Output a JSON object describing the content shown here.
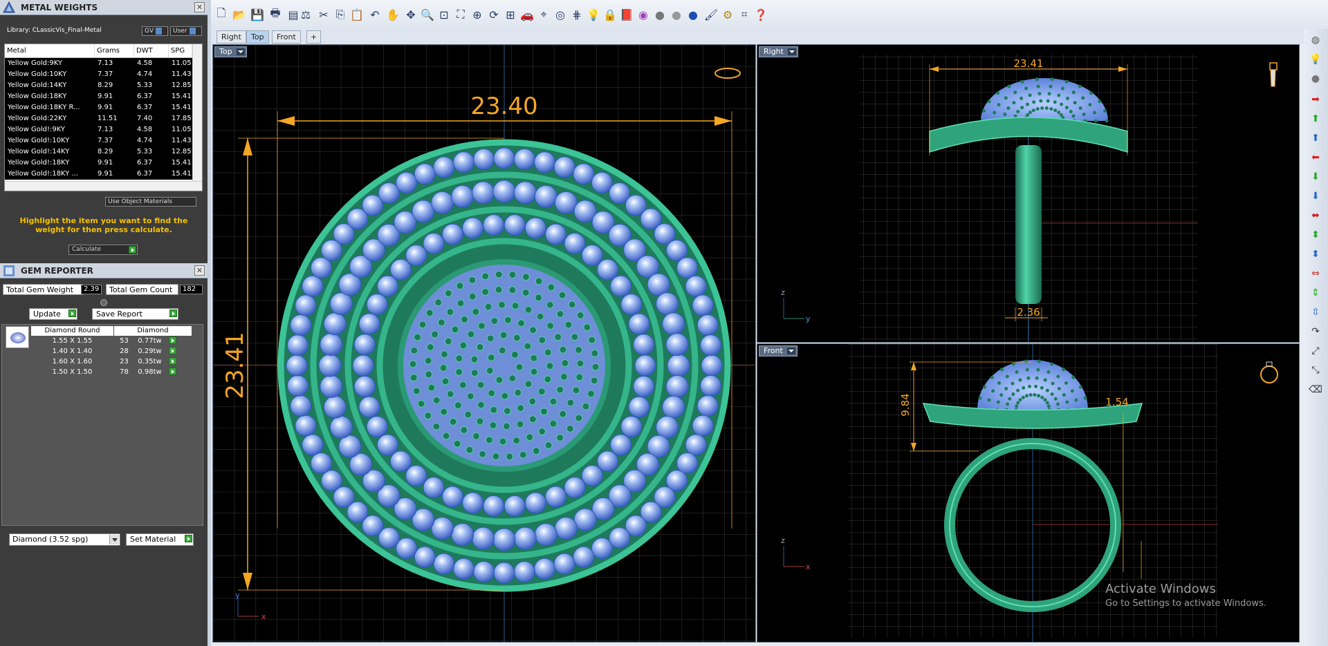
{
  "metal_panel": {
    "title": "METAL WEIGHTS",
    "library": "Library: CLassicVis_Final-Metal",
    "gv_label": "GV",
    "user_label": "User",
    "columns": [
      "Metal",
      "Grams",
      "DWT",
      "SPG"
    ],
    "rows": [
      [
        "Yellow Gold:9KY",
        "7.13",
        "4.58",
        "11.05"
      ],
      [
        "Yellow Gold:10KY",
        "7.37",
        "4.74",
        "11.43"
      ],
      [
        "Yellow Gold:14KY",
        "8.29",
        "5.33",
        "12.85"
      ],
      [
        "Yellow Gold:18KY",
        "9.91",
        "6.37",
        "15.41"
      ],
      [
        "Yellow Gold:18KY R...",
        "9.91",
        "6.37",
        "15.41"
      ],
      [
        "Yellow Gold:22KY",
        "11.51",
        "7.40",
        "17.85"
      ],
      [
        "Yellow Gold!:9KY",
        "7.13",
        "4.58",
        "11.05"
      ],
      [
        "Yellow Gold!:10KY",
        "7.37",
        "4.74",
        "11.43"
      ],
      [
        "Yellow Gold!:14KY",
        "8.29",
        "5.33",
        "12.85"
      ],
      [
        "Yellow Gold!:18KY",
        "9.91",
        "6.37",
        "15.41"
      ],
      [
        "Yellow Gold!:18KY ...",
        "9.91",
        "6.37",
        "15.41"
      ]
    ],
    "use_object_materials": "Use Object Materials",
    "hint": "Highlight the item you want to find the weight for then press calculate.",
    "calculate_label": "Calculate"
  },
  "gem_panel": {
    "title": "GEM REPORTER",
    "total_weight_label": "Total Gem Weight",
    "total_weight_value": "2.39",
    "total_count_label": "Total Gem Count",
    "total_count_value": "182",
    "update_label": "Update",
    "save_report_label": "Save Report",
    "columns": [
      "Diamond Round",
      "Diamond"
    ],
    "rows": [
      [
        "1.55 X 1.55",
        "53",
        "0.77tw"
      ],
      [
        "1.40 X 1.40",
        "28",
        "0.29tw"
      ],
      [
        "1.60 X 1.60",
        "23",
        "0.35tw"
      ],
      [
        "1.50 X 1.50",
        "78",
        "0.98tw"
      ]
    ],
    "material_select": "Diamond    (3.52 spg)",
    "set_material_label": "Set Material"
  },
  "tabs": [
    "Right",
    "Top",
    "Front"
  ],
  "active_tab": "Top",
  "viewports": {
    "top": {
      "label": "Top",
      "dim_width": "23.40",
      "dim_height": "23.41",
      "axis_y": "y",
      "axis_x": "x"
    },
    "right": {
      "label": "Right",
      "dim_width": "23.41",
      "dim_band": "2.36",
      "axis_z": "z",
      "axis_y": "y"
    },
    "front": {
      "label": "Front",
      "dim_height": "9.84",
      "dim_band": "1.54",
      "axis_z": "z",
      "axis_x": "x"
    }
  },
  "watermark": {
    "line1": "Activate Windows",
    "line2": "Go to Settings to activate Windows."
  },
  "colors": {
    "metal": "#2e9d78",
    "gem": "#7fa3ee",
    "dimension": "#f5a623",
    "hint": "#f5c000"
  }
}
